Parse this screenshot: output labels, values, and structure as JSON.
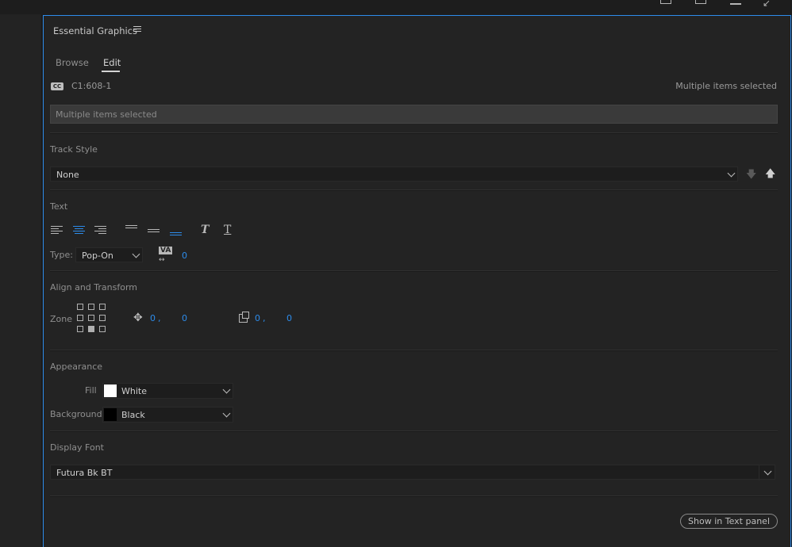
{
  "panel": {
    "title": "Essential Graphics",
    "tabs": [
      {
        "label": "Browse",
        "active": false
      },
      {
        "label": "Edit",
        "active": true
      }
    ],
    "accent_color": "#2d8ceb"
  },
  "caption": {
    "badge": "CC",
    "id": "C1:608-1",
    "status": "Multiple items selected",
    "text_value": "Multiple items selected"
  },
  "track_style": {
    "label": "Track Style",
    "value": "None"
  },
  "text_section": {
    "label": "Text",
    "type_label": "Type:",
    "type_value": "Pop-On",
    "tracking_value": "0",
    "tracking_icon_text": "VA",
    "faux_italic_glyph": "T",
    "faux_underline_glyph": "T"
  },
  "align_transform": {
    "label": "Align and Transform",
    "zone_label": "Zone",
    "position_x": "0",
    "position_sep": ",",
    "position_y": "0",
    "size_x": "0",
    "size_sep": ",",
    "size_y": "0"
  },
  "appearance": {
    "label": "Appearance",
    "fill_label": "Fill",
    "fill_value": "White",
    "fill_color": "#ffffff",
    "background_label": "Background",
    "background_value": "Black",
    "background_color": "#000000"
  },
  "display_font": {
    "label": "Display Font",
    "value": "Futura Bk BT"
  },
  "actions": {
    "show_in_text_panel": "Show in Text panel"
  }
}
